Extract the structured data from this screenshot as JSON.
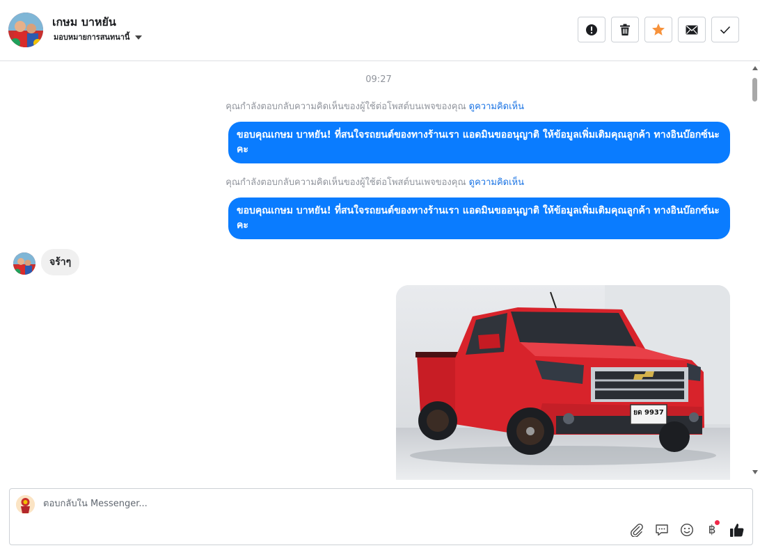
{
  "header": {
    "name": "เกษม บาหยัน",
    "assign_label": "มอบหมายการสนทนานี้",
    "actions": [
      {
        "icon": "alert-icon",
        "label": "spam"
      },
      {
        "icon": "trash-icon",
        "label": "delete"
      },
      {
        "icon": "star-icon",
        "label": "follow-up",
        "color": "#f7923b"
      },
      {
        "icon": "mail-icon",
        "label": "mark unread"
      },
      {
        "icon": "check-icon",
        "label": "done"
      }
    ]
  },
  "conversation": {
    "timestamp": "09:27",
    "notes": [
      {
        "text": "คุณกำลังตอบกลับความคิดเห็นของผู้ใช้ต่อโพสต์บนเพจของคุณ ",
        "link": "ดูความคิดเห็น"
      },
      {
        "text": "คุณกำลังตอบกลับความคิดเห็นของผู้ใช้ต่อโพสต์บนเพจของคุณ ",
        "link": "ดูความคิดเห็น"
      }
    ],
    "outgoing": [
      "ขอบคุณเกษม บาหยัน! ที่สนใจรถยนต์ของทางร้านเรา แอดมินขออนุญาติ ให้ข้อมูลเพิ่มเติมคุณลูกค้า ทางอินบ๊อกซ์นะคะ",
      "ขอบคุณเกษม บาหยัน! ที่สนใจรถยนต์ของทางร้านเรา แอดมินขออนุญาติ ให้ข้อมูลเพิ่มเติมคุณลูกค้า ทางอินบ๊อกซ์นะคะ"
    ],
    "incoming": [
      "จร้าๆ"
    ],
    "photo": {
      "subject": "red pickup truck",
      "plate": "ยด 9937"
    }
  },
  "composer": {
    "placeholder": "ตอบกลับใน Messenger...",
    "tools": [
      "paperclip-icon",
      "chat-bubble-icon",
      "smiley-icon",
      "baht-icon",
      "thumbs-up-icon"
    ],
    "baht_symbol": "฿"
  },
  "colors": {
    "accent": "#0a7cff",
    "link": "#1b74e4",
    "incoming_bubble": "#f0f0f0",
    "star": "#f7923b"
  }
}
